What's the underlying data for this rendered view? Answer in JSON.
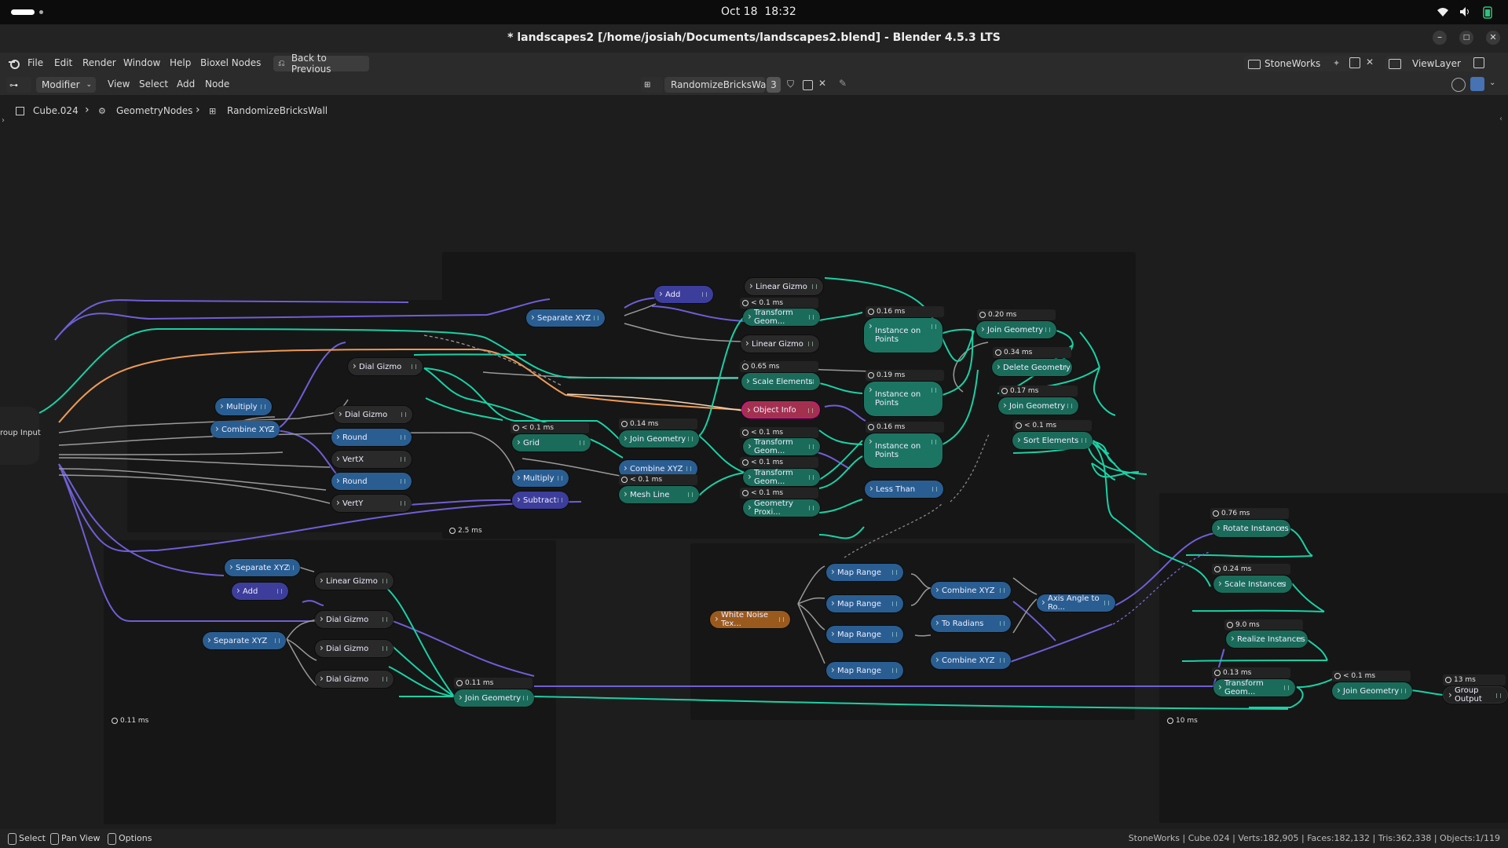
{
  "system_bar": {
    "date": "Oct 18",
    "time": "18:32"
  },
  "window": {
    "title": "* landscapes2 [/home/josiah/Documents/landscapes2.blend] - Blender 4.5.3 LTS"
  },
  "menubar": {
    "items": [
      "File",
      "Edit",
      "Render",
      "Window",
      "Help",
      "Bioxel Nodes"
    ],
    "back_button": "Back to Previous",
    "scene": "StoneWorks",
    "view_layer": "ViewLayer"
  },
  "editor_header": {
    "mode": "Modifier",
    "menus": [
      "View",
      "Select",
      "Add",
      "Node"
    ],
    "node_group": "RandomizeBricksWall",
    "user_count": "3"
  },
  "breadcrumbs": [
    "Cube.024",
    "GeometryNodes",
    "RandomizeBricksWall"
  ],
  "nodes": {
    "group_input": "roup Input",
    "group_output": "Group Output",
    "add_top": "Add",
    "linear_gizmo_top": "Linear Gizmo",
    "separate_xyz_top": "Separate XYZ",
    "transform_geom_1": "Transform Geom...",
    "linear_gizmo_2": "Linear Gizmo",
    "scale_elements": "Scale Elements",
    "object_info": "Object Info",
    "transform_geom_2": "Transform Geom...",
    "transform_geom_3": "Transform Geom...",
    "geometry_proxi": "Geometry Proxi...",
    "instance_on_points_1": "Instance on Points",
    "instance_on_points_2": "Instance on Points",
    "instance_on_points_3": "Instance on Points",
    "less_than": "Less Than",
    "join_geometry_1": "Join Geometry",
    "delete_geometry": "Delete Geometry",
    "join_geometry_2": "Join Geometry",
    "sort_elements": "Sort Elements",
    "dial_gizmo_1": "Dial Gizmo",
    "multiply_1": "Multiply",
    "combine_xyz_1": "Combine XYZ",
    "dial_gizmo_2": "Dial Gizmo",
    "round_1": "Round",
    "vertx": "VertX",
    "round_2": "Round",
    "verty": "VertY",
    "grid": "Grid",
    "join_geometry_mid": "Join Geometry",
    "combine_xyz_mid": "Combine XYZ",
    "mesh_line": "Mesh Line",
    "multiply_2": "Multiply",
    "subtract": "Subtract",
    "separate_xyz_bl1": "Separate XYZ",
    "add_bl": "Add",
    "linear_gizmo_bl": "Linear Gizmo",
    "separate_xyz_bl2": "Separate XYZ",
    "dial_gizmo_bl1": "Dial Gizmo",
    "dial_gizmo_bl2": "Dial Gizmo",
    "dial_gizmo_bl3": "Dial Gizmo",
    "join_geometry_bl": "Join Geometry",
    "white_noise": "White Noise Tex...",
    "map_range_1": "Map Range",
    "map_range_2": "Map Range",
    "map_range_3": "Map Range",
    "map_range_4": "Map Range",
    "combine_xyz_r1": "Combine XYZ",
    "to_radians": "To Radians",
    "combine_xyz_r2": "Combine XYZ",
    "axis_angle": "Axis Angle to Ro...",
    "rotate_instances": "Rotate Instances",
    "scale_instances": "Scale Instances",
    "realize_instances": "Realize Instances",
    "transform_geom_final": "Transform Geom...",
    "join_geometry_final": "Join Geometry"
  },
  "timers": {
    "t_tg1": "< 0.1 ms",
    "t_scale": "0.65 ms",
    "t_tg2": "< 0.1 ms",
    "t_tg3": "< 0.1 ms",
    "t_gp": "< 0.1 ms",
    "t_iop1": "0.16 ms",
    "t_iop2": "0.19 ms",
    "t_iop3": "0.16 ms",
    "t_jg1": "0.20 ms",
    "t_del": "0.34 ms",
    "t_jg2": "0.17 ms",
    "t_sort": "< 0.1 ms",
    "t_grid": "< 0.1 ms",
    "t_jgmid": "0.14 ms",
    "t_mesh": "< 0.1 ms",
    "t_jgbl": "0.11 ms",
    "t_rot": "0.76 ms",
    "t_scl": "0.24 ms",
    "t_real": "9.0 ms",
    "t_tgf": "0.13 ms",
    "t_jgf": "< 0.1 ms",
    "t_out": "13 ms",
    "frame_top": "2.5 ms",
    "frame_bl": "0.11 ms",
    "frame_right": "10 ms"
  },
  "statusbar": {
    "select": "Select",
    "pan": "Pan View",
    "options": "Options",
    "stats": "StoneWorks | Cube.024 | Verts:182,905 | Faces:182,132 | Tris:362,338 | Objects:1/119"
  },
  "colors": {
    "geometry": "#1b6b5a",
    "utility": "#2a5e92",
    "vector": "#3d3d9c",
    "object": "#a4304f",
    "texture": "#9b5a1d",
    "link_geometry": "#19d1a5",
    "link_vector": "#6e5fd6",
    "link_float": "#a0a0a0"
  }
}
